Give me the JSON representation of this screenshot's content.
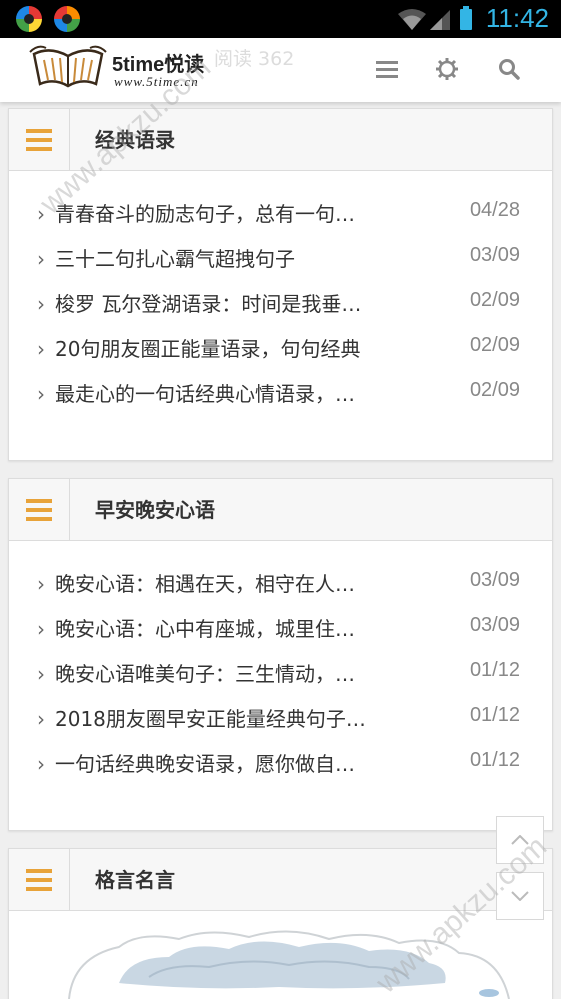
{
  "status_bar": {
    "time": "11:42"
  },
  "header": {
    "logo_title": "5time悦读",
    "logo_url": "www.5time.cn",
    "ghost_text": "阅读 362",
    "icons": [
      "menu-icon",
      "settings-icon",
      "search-icon"
    ]
  },
  "sections": [
    {
      "title": "经典语录",
      "items": [
        {
          "title": "青春奋斗的励志句子，总有一句…",
          "date": "04/28"
        },
        {
          "title": "三十二句扎心霸气超拽句子",
          "date": "03/09"
        },
        {
          "title": "梭罗 瓦尔登湖语录：时间是我垂…",
          "date": "02/09"
        },
        {
          "title": "20句朋友圈正能量语录，句句经典",
          "date": "02/09"
        },
        {
          "title": "最走心的一句话经典心情语录，…",
          "date": "02/09"
        }
      ]
    },
    {
      "title": "早安晚安心语",
      "items": [
        {
          "title": "晚安心语：相遇在天，相守在人…",
          "date": "03/09"
        },
        {
          "title": "晚安心语：心中有座城，城里住…",
          "date": "03/09"
        },
        {
          "title": "晚安心语唯美句子：三生情动，…",
          "date": "01/12"
        },
        {
          "title": "2018朋友圈早安正能量经典句子…",
          "date": "01/12"
        },
        {
          "title": "一句话经典晚安语录，愿你做自…",
          "date": "01/12"
        }
      ]
    },
    {
      "title": "格言名言",
      "items": []
    }
  ],
  "watermark": "www.apkzu.com",
  "colors": {
    "accent": "#e8a33a",
    "status_time": "#33b5e5",
    "date_text": "#888888"
  }
}
